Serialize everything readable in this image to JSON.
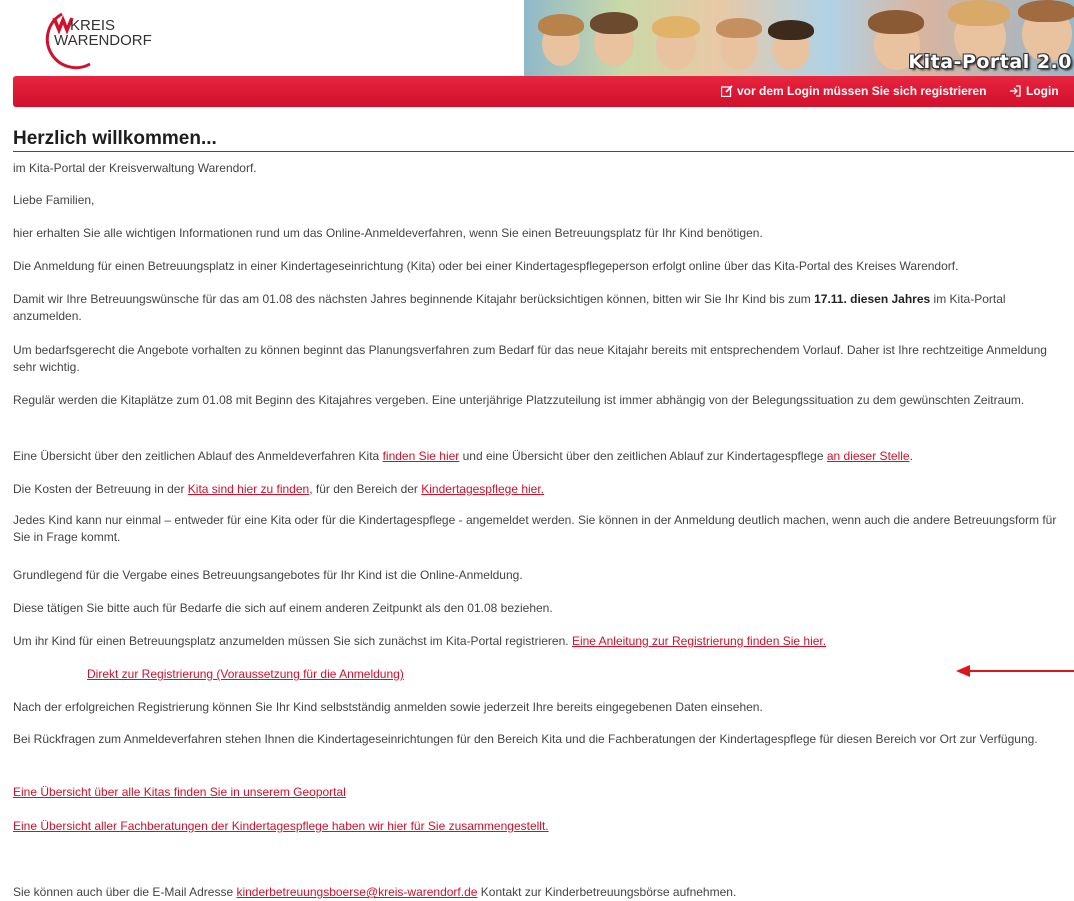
{
  "logo": {
    "line1": "KREIS",
    "line2": "WARENDORF"
  },
  "banner": {
    "title": "Kita-Portal 2.0"
  },
  "nav": {
    "register": "vor dem Login müssen Sie sich registrieren",
    "login": "Login"
  },
  "colors": {
    "accent": "#d2102b",
    "text": "#444444"
  },
  "main": {
    "heading": "Herzlich willkommen...",
    "p1": "im Kita-Portal der Kreisverwaltung Warendorf.",
    "p2": "Liebe Familien,",
    "p3": "hier erhalten Sie alle wichtigen Informationen rund um das Online-Anmeldeverfahren, wenn Sie einen Betreuungsplatz für Ihr Kind benötigen.",
    "p4": "Die Anmeldung für einen Betreuungsplatz in einer Kindertageseinrichtung (Kita) oder bei einer Kindertagespflegeperson erfolgt online über das Kita-Portal des Kreises Warendorf.",
    "p5a": "Damit wir Ihre Betreuungswünsche für das am 01.08 des nächsten Jahres beginnende Kitajahr berücksichtigen können, bitten wir Sie Ihr Kind bis zum ",
    "p5b": "17.11. diesen Jahres",
    "p5c": " im Kita-Portal anzumelden.",
    "p6": " Um bedarfsgerecht die Angebote vorhalten zu können beginnt das Planungsverfahren zum Bedarf für das neue Kitajahr bereits mit entsprechendem Vorlauf. Daher ist Ihre rechtzeitige Anmeldung sehr wichtig.",
    "p7": "Regulär werden die Kitaplätze zum 01.08 mit Beginn des Kitajahres vergeben. Eine unterjährige Platzzuteilung ist immer abhängig von der Belegungssituation zu dem gewünschten Zeitraum.",
    "p8a": "Eine Übersicht über den zeitlichen Ablauf des Anmeldeverfahren Kita ",
    "p8link1": "finden Sie hier",
    "p8b": " und eine Übersicht über den zeitlichen Ablauf zur Kindertagespflege ",
    "p8link2": "an dieser Stelle",
    "p8c": ".",
    "p9a": "Die Kosten der Betreuung in der ",
    "p9link1": "Kita sind hier zu finden",
    "p9b": ", für den Bereich der ",
    "p9link2": "Kindertagespflege hier.",
    "p10": "Jedes Kind kann nur einmal – entweder für eine Kita oder für die Kindertagespflege - angemeldet werden. Sie können in der Anmeldung deutlich machen, wenn auch die andere Betreuungsform für Sie in Frage kommt.",
    "p11": "Grundlegend für die Vergabe eines Betreuungsangebotes für Ihr Kind ist die Online-Anmeldung.",
    "p12": "Diese tätigen Sie bitte auch für Bedarfe die sich auf einem anderen Zeitpunkt als den 01.08 beziehen.",
    "p13a": "Um ihr Kind für einen Betreuungsplatz anzumelden müssen Sie sich zunächst im Kita-Portal registrieren. ",
    "p13link": "Eine Anleitung zur Registrierung finden Sie hier.",
    "direct_link": "Direkt zur Registrierung (Voraussetzung für die Anmeldung)",
    "p14": "Nach der erfolgreichen Registrierung können Sie Ihr Kind selbstständig anmelden sowie jederzeit Ihre bereits eingegebenen Daten einsehen.",
    "p15": "Bei Rückfragen zum Anmeldeverfahren stehen Ihnen die Kindertageseinrichtungen  für den Bereich Kita und die Fachberatungen der Kindertagespflege für diesen Bereich vor Ort zur Verfügung.",
    "link_geoportal": "Eine Übersicht über alle Kitas finden Sie in unserem Geoportal",
    "link_fachberatungen": "Eine Übersicht aller Fachberatungen der Kindertagespflege haben wir hier für Sie zusammengestellt.",
    "p16a": "Sie können auch über die E-Mail Adresse ",
    "p16link": "kinderbetreuungsboerse@kreis-warendorf.de",
    "p16b": " Kontakt zur Kinderbetreuungsbörse aufnehmen."
  }
}
